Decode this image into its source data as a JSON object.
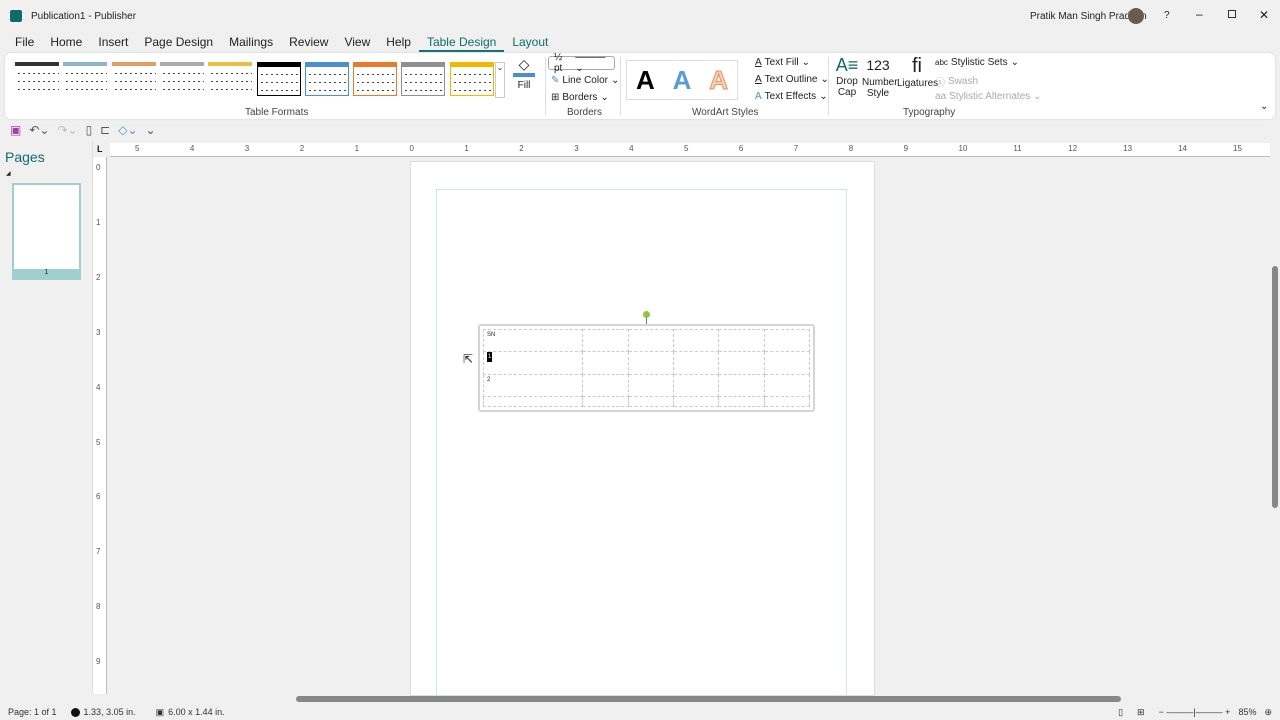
{
  "title": "Publication1  -  Publisher",
  "user": "Pratik Man Singh Pradhan",
  "menu": [
    "File",
    "Home",
    "Insert",
    "Page Design",
    "Mailings",
    "Review",
    "View",
    "Help",
    "Table Design",
    "Layout"
  ],
  "ribbon": {
    "groups": {
      "table_formats": "Table Formats",
      "borders": "Borders",
      "wordart": "WordArt Styles",
      "typography": "Typography"
    },
    "fill": "Fill",
    "line_weight": "½ pt",
    "line_color": "Line Color",
    "borders": "Borders",
    "wordart_letter": "A",
    "text_fill": "Text Fill",
    "text_outline": "Text Outline",
    "text_effects": "Text Effects",
    "drop_cap": "Drop Cap",
    "number_style": "Number Style",
    "number_glyph": "123",
    "ligatures": "Ligatures",
    "lig_glyph": "fi",
    "stylistic_sets": "Stylistic Sets",
    "swash": "Swash",
    "stylistic_alternates": "Stylistic Alternates",
    "format_colors": [
      "#333333",
      "#8fb4d0",
      "#e0a060",
      "#aaaaaa",
      "#e8c040",
      "#000000",
      "#4a8fd0",
      "#e87a30",
      "#909090",
      "#f0b800"
    ]
  },
  "pages_panel": {
    "title": "Pages",
    "page_number": "1"
  },
  "ruler": {
    "h": [
      "5",
      "4",
      "3",
      "2",
      "1",
      "0",
      "1",
      "2",
      "3",
      "4",
      "5",
      "6",
      "7",
      "8",
      "9",
      "10",
      "11",
      "12",
      "13",
      "14",
      "15"
    ],
    "v": [
      "0",
      "1",
      "2",
      "3",
      "4",
      "5",
      "6",
      "7",
      "8",
      "9"
    ]
  },
  "table": {
    "rows": [
      [
        "SN",
        "",
        "",
        "",
        "",
        ""
      ],
      [
        "1",
        "",
        "",
        "",
        "",
        ""
      ],
      [
        "2",
        "",
        "",
        "",
        "",
        ""
      ],
      [
        "",
        "",
        "",
        "",
        "",
        ""
      ]
    ]
  },
  "status": {
    "page": "Page: 1 of 1",
    "position": "1.33, 3.05 in.",
    "size": "6.00 x 1.44 in.",
    "zoom": "85%"
  }
}
